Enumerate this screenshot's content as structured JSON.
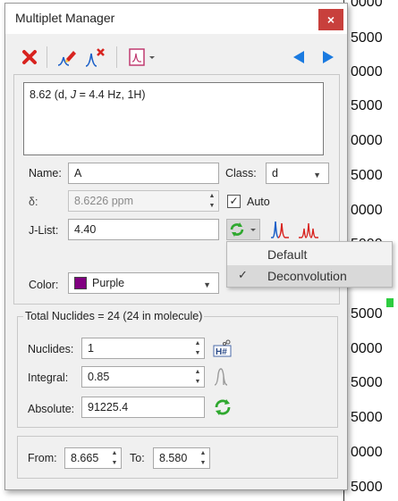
{
  "window": {
    "title": "Multiplet Manager",
    "close_label": "×"
  },
  "toolbar": {
    "icons": [
      "delete-icon",
      "edit-multiplet-icon",
      "remove-multiplet-icon",
      "report-icon",
      "previous-arrow-icon",
      "next-arrow-icon"
    ]
  },
  "multiplet": {
    "description_prefix": "8.62 (d, ",
    "description_j": "J",
    "description_suffix": " = 4.4 Hz, 1H)",
    "name_label": "Name:",
    "name_value": "A",
    "class_label": "Class:",
    "class_value": "d",
    "delta_label": "δ:",
    "delta_value": "8.6226 ppm",
    "auto_label": "Auto",
    "auto_checked": "✓",
    "jlist_label": "J-List:",
    "jlist_value": "4.40",
    "color_label": "Color:",
    "color_value": "Purple",
    "color_hex": "#800080"
  },
  "menu": {
    "items": [
      {
        "label": "Default",
        "checked": ""
      },
      {
        "label": "Deconvolution",
        "checked": "✓"
      }
    ]
  },
  "nuclides": {
    "group_title": "Total Nuclides = 24 (24 in molecule)",
    "nuclides_label": "Nuclides:",
    "nuclides_value": "1",
    "integral_label": "Integral:",
    "integral_value": "0.85",
    "absolute_label": "Absolute:",
    "absolute_value": "91225.4"
  },
  "range": {
    "from_label": "From:",
    "from_value": "8.665",
    "to_label": "To:",
    "to_value": "8.580"
  },
  "background_axis": {
    "labels": [
      "0000",
      "5000",
      "0000",
      "5000",
      "0000",
      "5000",
      "0000",
      "5000",
      "0000",
      "5000",
      "0000",
      "5000",
      "5000",
      "0000",
      "5000",
      "0000",
      "5000",
      "0000",
      "5000",
      "5000"
    ]
  }
}
